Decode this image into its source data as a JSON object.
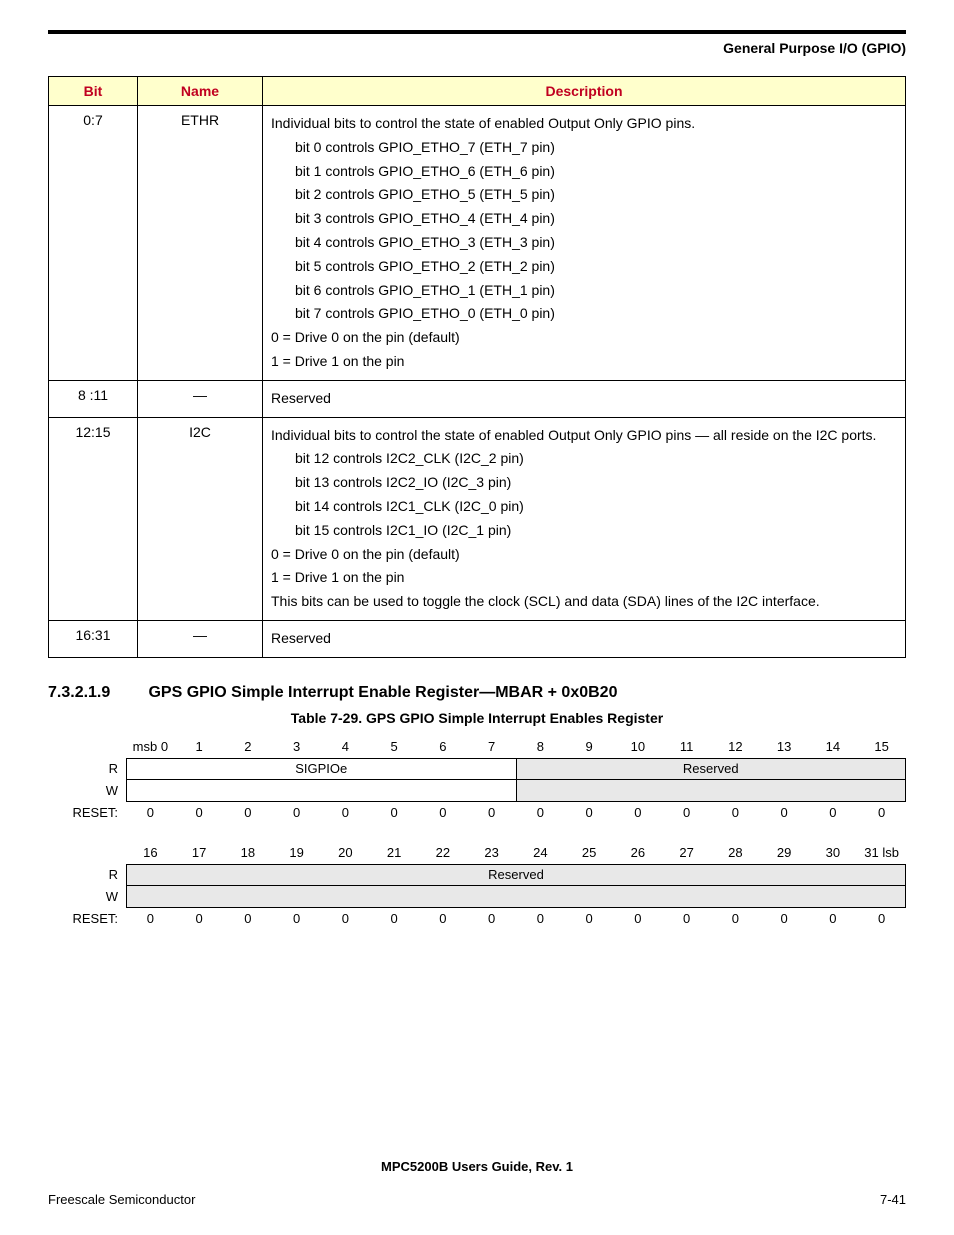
{
  "header": {
    "section": "General Purpose I/O (GPIO)"
  },
  "regtable": {
    "headers": {
      "bit": "Bit",
      "name": "Name",
      "desc": "Description"
    },
    "rows": [
      {
        "bit": "0:7",
        "name": "ETHR",
        "desc": {
          "intro": "Individual bits to control the state of enabled Output Only GPIO pins.",
          "lines": [
            "bit 0 controls GPIO_ETHO_7 (ETH_7 pin)",
            "bit 1 controls GPIO_ETHO_6 (ETH_6 pin)",
            "bit 2 controls GPIO_ETHO_5 (ETH_5 pin)",
            "bit 3 controls GPIO_ETHO_4 (ETH_4 pin)",
            "bit 4 controls GPIO_ETHO_3 (ETH_3 pin)",
            "bit 5 controls GPIO_ETHO_2 (ETH_2 pin)",
            "bit 6 controls GPIO_ETHO_1 (ETH_1 pin)",
            "bit 7 controls GPIO_ETHO_0 (ETH_0 pin)"
          ],
          "v0": "0 = Drive 0 on the pin (default)",
          "v1": "1 = Drive 1 on the pin"
        }
      },
      {
        "bit": "8 :11",
        "name": "—",
        "desc_plain": "Reserved"
      },
      {
        "bit": "12:15",
        "name": "I2C",
        "desc": {
          "intro": "Individual bits to control the state of enabled Output Only GPIO pins — all reside on the I2C ports.",
          "lines": [
            "bit 12 controls I2C2_CLK (I2C_2 pin)",
            "bit 13 controls I2C2_IO (I2C_3 pin)",
            "bit 14 controls I2C1_CLK (I2C_0 pin)",
            "bit 15 controls I2C1_IO (I2C_1 pin)"
          ],
          "v0": "0 = Drive 0 on the pin (default)",
          "v1": "1 = Drive 1 on the pin",
          "note": "This bits can be used to toggle the clock (SCL) and data (SDA) lines of the I2C interface."
        }
      },
      {
        "bit": "16:31",
        "name": "—",
        "desc_plain": "Reserved"
      }
    ]
  },
  "section": {
    "num": "7.3.2.1.9",
    "title": "GPS GPIO Simple Interrupt Enable Register—MBAR + 0x0B20",
    "caption": "Table 7-29. GPS GPIO Simple Interrupt Enables Register"
  },
  "diagram": {
    "bits_hi": [
      "msb 0",
      "1",
      "2",
      "3",
      "4",
      "5",
      "6",
      "7",
      "8",
      "9",
      "10",
      "11",
      "12",
      "13",
      "14",
      "15"
    ],
    "bits_lo": [
      "16",
      "17",
      "18",
      "19",
      "20",
      "21",
      "22",
      "23",
      "24",
      "25",
      "26",
      "27",
      "28",
      "29",
      "30",
      "31 lsb"
    ],
    "R": "R",
    "W": "W",
    "RESET": "RESET:",
    "field_sigpioe": "SIGPIOe",
    "field_reserved": "Reserved",
    "reset_hi": [
      "0",
      "0",
      "0",
      "0",
      "0",
      "0",
      "0",
      "0",
      "0",
      "0",
      "0",
      "0",
      "0",
      "0",
      "0",
      "0"
    ],
    "reset_lo": [
      "0",
      "0",
      "0",
      "0",
      "0",
      "0",
      "0",
      "0",
      "0",
      "0",
      "0",
      "0",
      "0",
      "0",
      "0",
      "0"
    ]
  },
  "footer": {
    "guide": "MPC5200B Users Guide, Rev. 1",
    "left": "Freescale Semiconductor",
    "right": "7-41"
  }
}
